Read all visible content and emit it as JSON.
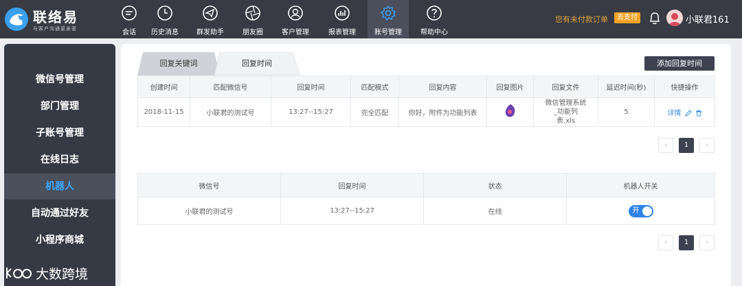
{
  "header": {
    "logo_title": "联络易",
    "logo_subtitle": "与客户沟通更亲密",
    "nav": [
      {
        "label": "会话",
        "icon": "chat-icon"
      },
      {
        "label": "历史消息",
        "icon": "clock-icon"
      },
      {
        "label": "群发助手",
        "icon": "paper-plane-icon"
      },
      {
        "label": "朋友圈",
        "icon": "aperture-icon"
      },
      {
        "label": "客户管理",
        "icon": "user-icon"
      },
      {
        "label": "报表管理",
        "icon": "chart-icon"
      },
      {
        "label": "账号管理",
        "icon": "gear-icon",
        "active": true
      },
      {
        "label": "帮助中心",
        "icon": "question-icon"
      }
    ],
    "unpaid_text": "您有未付款订单",
    "pay_label": "去支付",
    "username": "小联君161"
  },
  "sidebar": {
    "items": [
      {
        "label": "微信号管理"
      },
      {
        "label": "部门管理"
      },
      {
        "label": "子账号管理"
      },
      {
        "label": "在线日志"
      },
      {
        "label": "机器人",
        "active": true
      },
      {
        "label": "自动通过好友"
      },
      {
        "label": "小程序商城"
      }
    ]
  },
  "tabs": [
    {
      "label": "回复关键词"
    },
    {
      "label": "回复时间",
      "active": true
    }
  ],
  "add_button_label": "添加回复时间",
  "reply_table": {
    "headers": [
      "创建时间",
      "匹配微信号",
      "回复时间",
      "匹配模式",
      "回复内容",
      "回复图片",
      "回复文件",
      "延迟时间(秒)",
      "快捷操作"
    ],
    "rows": [
      {
        "created": "2018-11-15",
        "wechat": "小联君的测试号",
        "time": "13:27--15:27",
        "mode": "完全匹配",
        "content": "你好，附件为功能列表",
        "image_icon": "image-thumbnail-icon",
        "file": "微信管理系统_功能列表.xls",
        "delay": "5",
        "detail_label": "详情"
      }
    ]
  },
  "pager1": {
    "current": "1"
  },
  "robot_table": {
    "headers": [
      "微信号",
      "回复时间",
      "状态",
      "机器人开关"
    ],
    "rows": [
      {
        "wechat": "小联君的测试号",
        "time": "13:27--15:27",
        "status": "在线",
        "switch_label": "开",
        "switch_on": true
      }
    ]
  },
  "pager2": {
    "current": "1"
  },
  "watermark": {
    "text": "大数跨境"
  },
  "colors": {
    "accent": "#2f83e8",
    "topbar": "#383b44",
    "sidebar": "#353a44",
    "active_text": "#3fa6ff",
    "warning": "#e0a13a"
  }
}
